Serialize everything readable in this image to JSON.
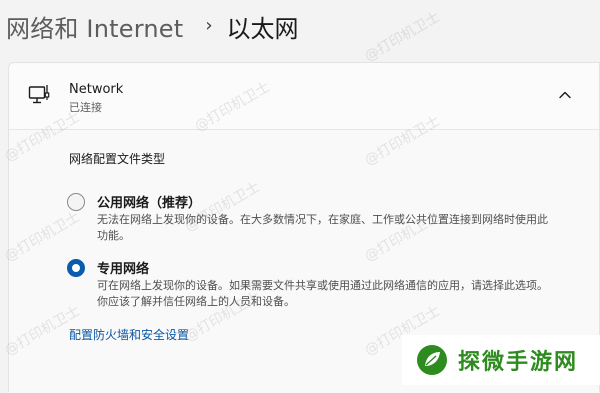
{
  "breadcrumb": {
    "parent": "网络和 Internet",
    "separator": "›",
    "current": "以太网"
  },
  "network": {
    "icon": "ethernet-monitor-icon",
    "name": "Network",
    "status": "已连接",
    "expand_icon": "chevron-up-icon"
  },
  "profile": {
    "section_label": "网络配置文件类型",
    "options": [
      {
        "title": "公用网络（推荐）",
        "description": "无法在网络上发现你的设备。在大多数情况下，在家庭、工作或公共位置连接到网络时使用此功能。",
        "selected": false
      },
      {
        "title": "专用网络",
        "description": "可在网络上发现你的设备。如果需要文件共享或使用通过此网络通信的应用，请选择此选项。你应该了解并信任网络上的人员和设备。",
        "selected": true
      }
    ],
    "firewall_link": "配置防火墙和安全设置"
  },
  "watermark": "@打印机卫士",
  "brand": {
    "name": "探微手游网",
    "color": "#2e8b1f"
  },
  "colors": {
    "accent": "#0b5cad",
    "link": "#0a56a6"
  }
}
